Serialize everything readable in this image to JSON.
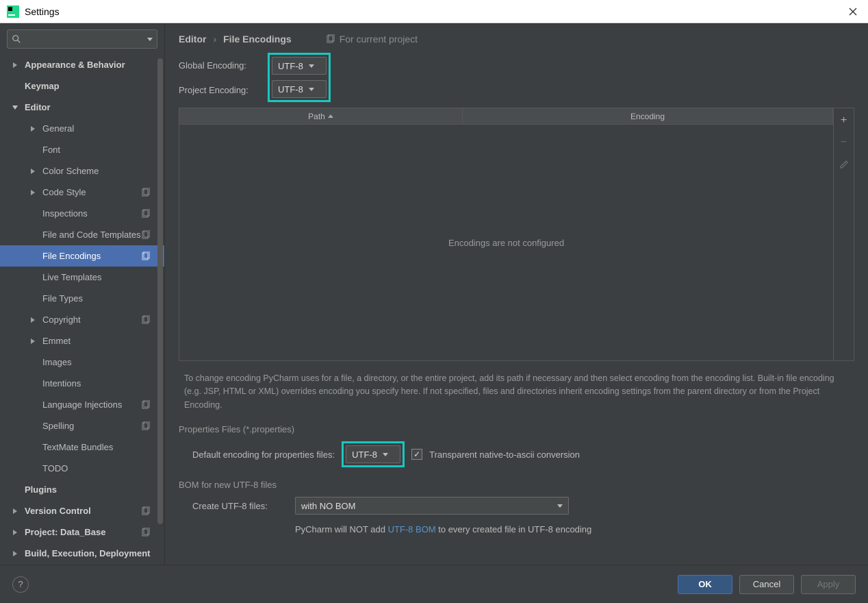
{
  "window": {
    "title": "Settings"
  },
  "search": {
    "placeholder": ""
  },
  "sidebar": {
    "items": [
      {
        "label": "Appearance & Behavior",
        "arrow": "right",
        "bold": true
      },
      {
        "label": "Keymap",
        "arrow": "",
        "bold": true
      },
      {
        "label": "Editor",
        "arrow": "down",
        "bold": true
      },
      {
        "label": "General",
        "arrow": "right",
        "lvl": 1
      },
      {
        "label": "Font",
        "arrow": "",
        "lvl": 1
      },
      {
        "label": "Color Scheme",
        "arrow": "right",
        "lvl": 1
      },
      {
        "label": "Code Style",
        "arrow": "right",
        "lvl": 1,
        "badge": true
      },
      {
        "label": "Inspections",
        "arrow": "",
        "lvl": 1,
        "badge": true
      },
      {
        "label": "File and Code Templates",
        "arrow": "",
        "lvl": 1,
        "badge": true
      },
      {
        "label": "File Encodings",
        "arrow": "",
        "lvl": 1,
        "badge": true,
        "selected": true
      },
      {
        "label": "Live Templates",
        "arrow": "",
        "lvl": 1
      },
      {
        "label": "File Types",
        "arrow": "",
        "lvl": 1
      },
      {
        "label": "Copyright",
        "arrow": "right",
        "lvl": 1,
        "badge": true
      },
      {
        "label": "Emmet",
        "arrow": "right",
        "lvl": 1
      },
      {
        "label": "Images",
        "arrow": "",
        "lvl": 1
      },
      {
        "label": "Intentions",
        "arrow": "",
        "lvl": 1
      },
      {
        "label": "Language Injections",
        "arrow": "",
        "lvl": 1,
        "badge": true
      },
      {
        "label": "Spelling",
        "arrow": "",
        "lvl": 1,
        "badge": true
      },
      {
        "label": "TextMate Bundles",
        "arrow": "",
        "lvl": 1
      },
      {
        "label": "TODO",
        "arrow": "",
        "lvl": 1
      },
      {
        "label": "Plugins",
        "arrow": "",
        "bold": true
      },
      {
        "label": "Version Control",
        "arrow": "right",
        "bold": true,
        "badge": true
      },
      {
        "label": "Project: Data_Base",
        "arrow": "right",
        "bold": true,
        "badge": true
      },
      {
        "label": "Build, Execution, Deployment",
        "arrow": "right",
        "bold": true
      }
    ]
  },
  "breadcrumb": {
    "a": "Editor",
    "b": "File Encodings",
    "hint": "For current project"
  },
  "form": {
    "global_label": "Global Encoding:",
    "global_value": "UTF-8",
    "project_label": "Project Encoding:",
    "project_value": "UTF-8"
  },
  "table": {
    "col_path": "Path",
    "col_enc": "Encoding",
    "empty": "Encodings are not configured"
  },
  "help_text": "To change encoding PyCharm uses for a file, a directory, or the entire project, add its path if necessary and then select encoding from the encoding list. Built-in file encoding (e.g. JSP, HTML or XML) overrides encoding you specify here. If not specified, files and directories inherit encoding settings from the parent directory or from the Project Encoding.",
  "props": {
    "section": "Properties Files (*.properties)",
    "label": "Default encoding for properties files:",
    "value": "UTF-8",
    "checkbox": "Transparent native-to-ascii conversion"
  },
  "bom": {
    "section": "BOM for new UTF-8 files",
    "label": "Create UTF-8 files:",
    "value": "with NO BOM",
    "hint_a": "PyCharm will NOT add ",
    "hint_link": "UTF-8 BOM",
    "hint_b": " to every created file in UTF-8 encoding"
  },
  "footer": {
    "ok": "OK",
    "cancel": "Cancel",
    "apply": "Apply"
  }
}
